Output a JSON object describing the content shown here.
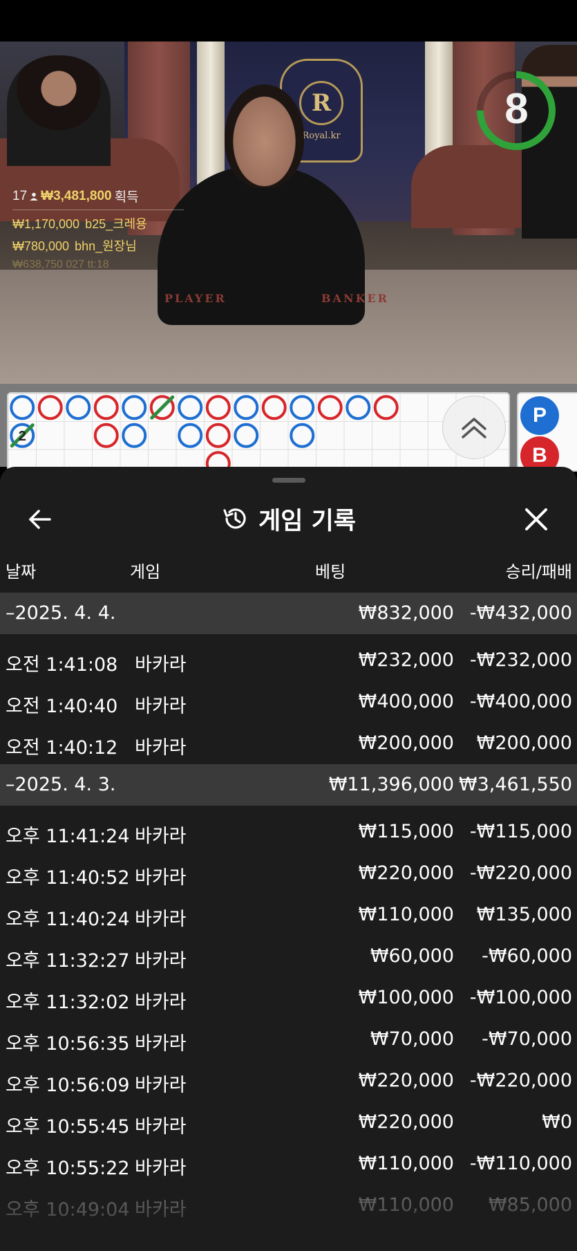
{
  "video": {
    "brand": "Royal.kr",
    "crest_letter": "R",
    "table_player": "PLAYER",
    "table_banker": "BANKER",
    "timer": {
      "value": "8",
      "progress": 0.75,
      "color": "#2fa33a"
    },
    "wins": {
      "count": "17",
      "total": "₩3,481,800",
      "suffix": "획득",
      "rows": [
        {
          "amount": "₩1,170,000",
          "name": "b25_크레용"
        },
        {
          "amount": "₩780,000",
          "name": "bhn_원장님"
        }
      ],
      "faded": "₩638,750 027 tt:18"
    }
  },
  "road": {
    "colors": {
      "player": "#1e6fd1",
      "banker": "#d6262b",
      "tie": "#2e8b3e"
    },
    "scroll_icon": "double-chevron-up-icon",
    "cells": [
      {
        "c": 0,
        "r": 0,
        "t": "P"
      },
      {
        "c": 0,
        "r": 1,
        "t": "P",
        "tie": true,
        "label": "2"
      },
      {
        "c": 1,
        "r": 0,
        "t": "B"
      },
      {
        "c": 2,
        "r": 0,
        "t": "P"
      },
      {
        "c": 3,
        "r": 0,
        "t": "B"
      },
      {
        "c": 3,
        "r": 1,
        "t": "B"
      },
      {
        "c": 4,
        "r": 0,
        "t": "P"
      },
      {
        "c": 4,
        "r": 1,
        "t": "P"
      },
      {
        "c": 5,
        "r": 0,
        "t": "B",
        "tie": true
      },
      {
        "c": 6,
        "r": 0,
        "t": "P"
      },
      {
        "c": 6,
        "r": 1,
        "t": "P"
      },
      {
        "c": 7,
        "r": 0,
        "t": "B"
      },
      {
        "c": 7,
        "r": 1,
        "t": "B"
      },
      {
        "c": 7,
        "r": 2,
        "t": "B"
      },
      {
        "c": 8,
        "r": 0,
        "t": "P"
      },
      {
        "c": 8,
        "r": 1,
        "t": "P"
      },
      {
        "c": 9,
        "r": 0,
        "t": "B"
      },
      {
        "c": 10,
        "r": 0,
        "t": "P"
      },
      {
        "c": 10,
        "r": 1,
        "t": "P"
      },
      {
        "c": 11,
        "r": 0,
        "t": "B"
      },
      {
        "c": 12,
        "r": 0,
        "t": "P"
      },
      {
        "c": 13,
        "r": 0,
        "t": "B"
      }
    ],
    "side": {
      "player_label": "P",
      "banker_label": "B"
    }
  },
  "sheet": {
    "title": "게임 기록",
    "title_icon": "history-icon",
    "back_icon": "arrow-left-icon",
    "close_icon": "close-icon",
    "columns": {
      "date": "날짜",
      "game": "게임",
      "bet": "베팅",
      "result": "승리/패배"
    },
    "groups": [
      {
        "date": "–2025. 4. 4.",
        "total_bet": "₩832,000",
        "total_result": "-₩432,000",
        "rows": [
          {
            "time": "오전 1:41:08",
            "game": "바카라",
            "bet": "₩232,000",
            "result": "-₩232,000"
          },
          {
            "time": "오전 1:40:40",
            "game": "바카라",
            "bet": "₩400,000",
            "result": "-₩400,000"
          },
          {
            "time": "오전 1:40:12",
            "game": "바카라",
            "bet": "₩200,000",
            "result": "₩200,000"
          }
        ]
      },
      {
        "date": "–2025. 4. 3.",
        "total_bet": "₩11,396,000",
        "total_result": "₩3,461,550",
        "rows": [
          {
            "time": "오후 11:41:24",
            "game": "바카라",
            "bet": "₩115,000",
            "result": "-₩115,000"
          },
          {
            "time": "오후 11:40:52",
            "game": "바카라",
            "bet": "₩220,000",
            "result": "-₩220,000"
          },
          {
            "time": "오후 11:40:24",
            "game": "바카라",
            "bet": "₩110,000",
            "result": "₩135,000"
          },
          {
            "time": "오후 11:32:27",
            "game": "바카라",
            "bet": "₩60,000",
            "result": "-₩60,000"
          },
          {
            "time": "오후 11:32:02",
            "game": "바카라",
            "bet": "₩100,000",
            "result": "-₩100,000"
          },
          {
            "time": "오후 10:56:35",
            "game": "바카라",
            "bet": "₩70,000",
            "result": "-₩70,000"
          },
          {
            "time": "오후 10:56:09",
            "game": "바카라",
            "bet": "₩220,000",
            "result": "-₩220,000"
          },
          {
            "time": "오후 10:55:45",
            "game": "바카라",
            "bet": "₩220,000",
            "result": "₩0"
          },
          {
            "time": "오후 10:55:22",
            "game": "바카라",
            "bet": "₩110,000",
            "result": "-₩110,000"
          },
          {
            "time": "오후 10:49:04",
            "game": "바카라",
            "bet": "₩110,000",
            "result": "₩85,000"
          }
        ]
      }
    ]
  }
}
